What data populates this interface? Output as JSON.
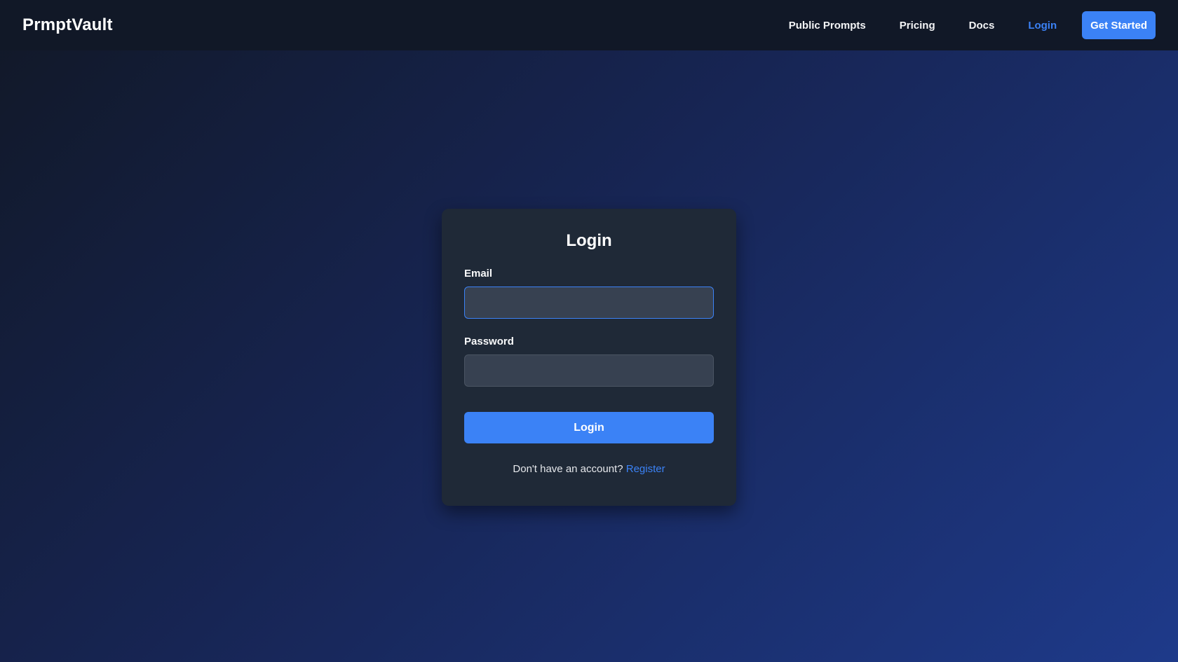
{
  "navbar": {
    "brand": "PrmptVault",
    "links": [
      {
        "label": "Public Prompts"
      },
      {
        "label": "Pricing"
      },
      {
        "label": "Docs"
      },
      {
        "label": "Login"
      }
    ],
    "cta_label": "Get Started"
  },
  "login_card": {
    "title": "Login",
    "email_label": "Email",
    "email_value": "",
    "password_label": "Password",
    "password_value": "",
    "submit_label": "Login",
    "footer_prompt": "Don't have an account?",
    "register_label": "Register"
  },
  "colors": {
    "accent": "#3b82f6",
    "navbar_bg": "#111827",
    "card_bg": "#1f2937",
    "input_bg": "#374151"
  }
}
